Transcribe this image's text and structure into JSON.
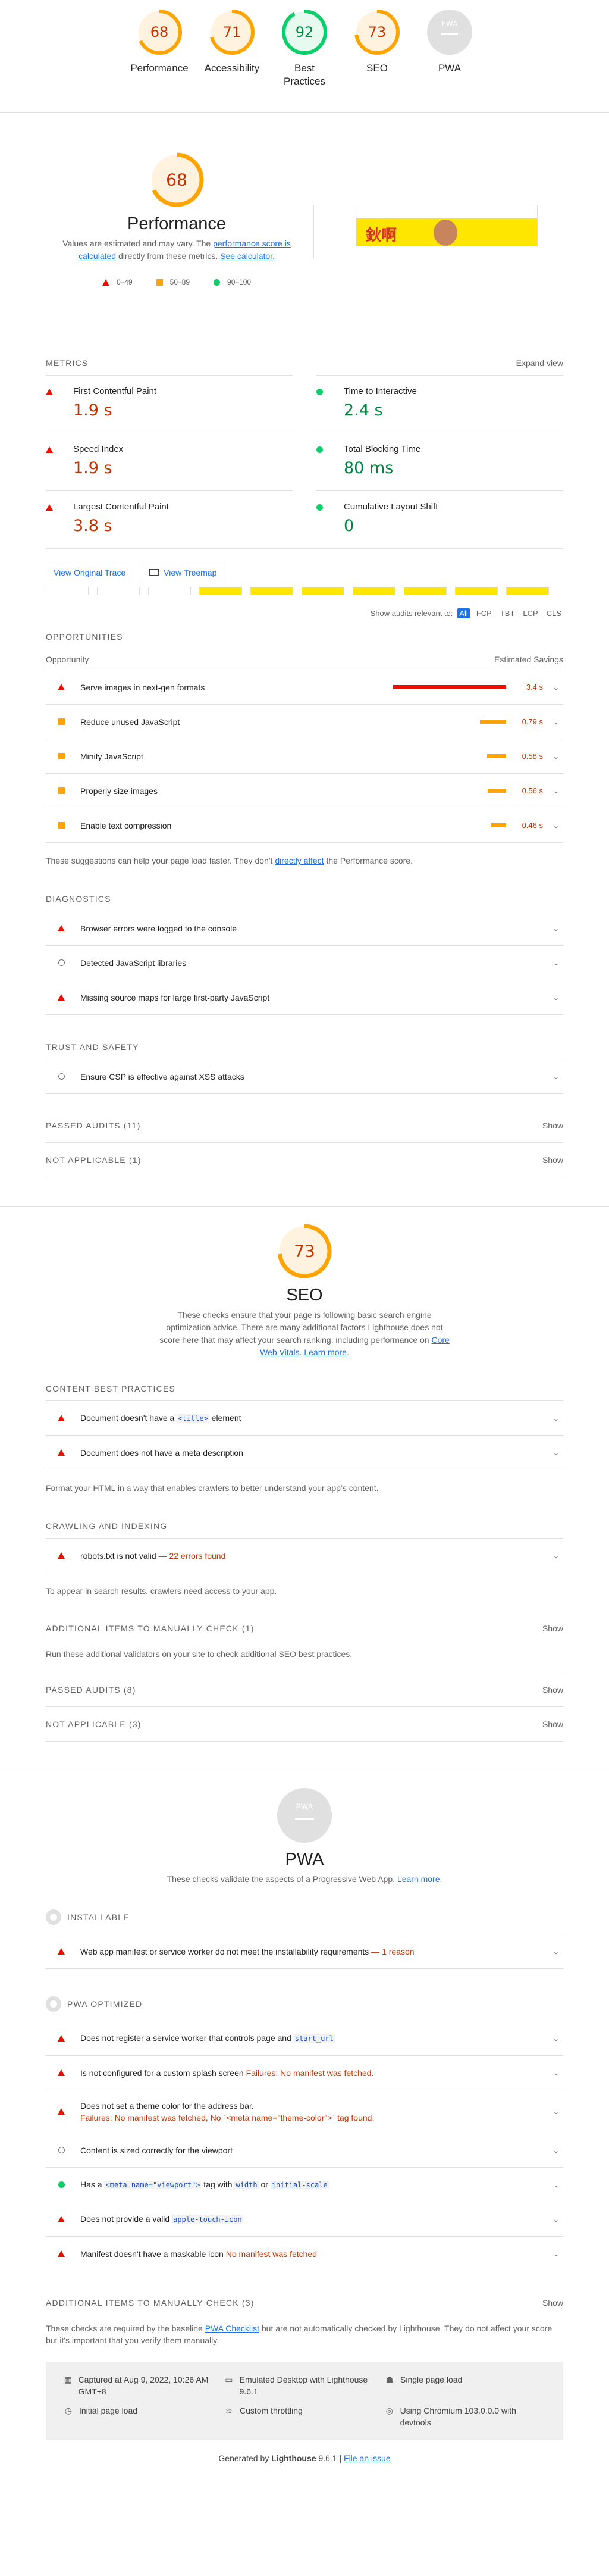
{
  "summary": [
    {
      "label": "Performance",
      "score": "68",
      "score_num": 68,
      "color": "#ffa400"
    },
    {
      "label": "Accessibility",
      "score": "71",
      "score_num": 71,
      "color": "#ffa400"
    },
    {
      "label": "Best Practices",
      "score": "92",
      "score_num": 92,
      "color": "#0cce6b"
    },
    {
      "label": "SEO",
      "score": "73",
      "score_num": 73,
      "color": "#ffa400"
    },
    {
      "label": "PWA",
      "score": "PWA",
      "score_num": 0,
      "color": "#e0e0e0"
    }
  ],
  "performance": {
    "score": "68",
    "title": "Performance",
    "desc_1": "Values are estimated and may vary. The ",
    "desc_link_1": "performance score is calculated",
    "desc_2": " directly from these metrics. ",
    "desc_link_2": "See calculator.",
    "legend": [
      "0–49",
      "50–89",
      "90–100"
    ],
    "metrics_label": "METRICS",
    "expand_view": "Expand view",
    "metrics": [
      {
        "name": "First Contentful Paint",
        "value": "1.9 s",
        "status": "fail"
      },
      {
        "name": "Time to Interactive",
        "value": "2.4 s",
        "status": "pass"
      },
      {
        "name": "Speed Index",
        "value": "1.9 s",
        "status": "fail"
      },
      {
        "name": "Total Blocking Time",
        "value": "80 ms",
        "status": "pass"
      },
      {
        "name": "Largest Contentful Paint",
        "value": "3.8 s",
        "status": "fail"
      },
      {
        "name": "Cumulative Layout Shift",
        "value": "0",
        "status": "pass"
      }
    ],
    "view_trace": "View Original Trace",
    "view_treemap": "View Treemap",
    "filter_label": "Show audits relevant to:",
    "filters": [
      "All",
      "FCP",
      "TBT",
      "LCP",
      "CLS"
    ],
    "opportunities_label": "OPPORTUNITIES",
    "opp_col_1": "Opportunity",
    "opp_col_2": "Estimated Savings",
    "opportunities": [
      {
        "name": "Serve images in next-gen formats",
        "savings": "3.4 s",
        "status": "fail",
        "fraction": 1.0
      },
      {
        "name": "Reduce unused JavaScript",
        "savings": "0.79 s",
        "status": "average",
        "fraction": 0.23
      },
      {
        "name": "Minify JavaScript",
        "savings": "0.58 s",
        "status": "average",
        "fraction": 0.17
      },
      {
        "name": "Properly size images",
        "savings": "0.56 s",
        "status": "average",
        "fraction": 0.165
      },
      {
        "name": "Enable text compression",
        "savings": "0.46 s",
        "status": "average",
        "fraction": 0.135
      }
    ],
    "opp_note_1": "These suggestions can help your page load faster. They don't ",
    "opp_note_link": "directly affect",
    "opp_note_2": " the Performance score.",
    "diagnostics_label": "DIAGNOSTICS",
    "diagnostics": [
      {
        "name": "Browser errors were logged to the console",
        "status": "fail"
      },
      {
        "name": "Detected JavaScript libraries",
        "status": "info"
      },
      {
        "name": "Missing source maps for large first-party JavaScript",
        "status": "fail"
      }
    ],
    "trust_label": "TRUST AND SAFETY",
    "trust": [
      {
        "name": "Ensure CSP is effective against XSS attacks",
        "status": "info"
      }
    ],
    "passed": "PASSED AUDITS (11)",
    "not_applicable": "NOT APPLICABLE (1)",
    "show": "Show"
  },
  "seo": {
    "score": "73",
    "title": "SEO",
    "desc_1": "These checks ensure that your page is following basic search engine optimization advice. There are many additional factors Lighthouse does not score here that may affect your search ranking, including performance on ",
    "desc_link_1": "Core Web Vitals",
    "desc_2": ". ",
    "desc_link_2": "Learn more",
    "desc_3": ".",
    "content_label": "CONTENT BEST PRACTICES",
    "audit_1_pre": "Document doesn't have a ",
    "audit_1_code": "<title>",
    "audit_1_post": " element",
    "audit_2": "Document does not have a meta description",
    "content_note": "Format your HTML in a way that enables crawlers to better understand your app’s content.",
    "crawl_label": "CRAWLING AND INDEXING",
    "robots": "robots.txt is not valid",
    "robots_warn": " — 22 errors found",
    "crawl_note": "To appear in search results, crawlers need access to your app.",
    "manual": "ADDITIONAL ITEMS TO MANUALLY CHECK (1)",
    "manual_note": "Run these additional validators on your site to check additional SEO best practices.",
    "passed": "PASSED AUDITS (8)",
    "not_applicable": "NOT APPLICABLE (3)",
    "show": "Show"
  },
  "pwa": {
    "badge": "PWA",
    "title": "PWA",
    "desc_1": "These checks validate the aspects of a Progressive Web App. ",
    "desc_link": "Learn more",
    "desc_2": ".",
    "installable_label": "INSTALLABLE",
    "installable_audit": "Web app manifest or service worker do not meet the installability requirements",
    "installable_warn": " — 1 reason",
    "optimized_label": "PWA OPTIMIZED",
    "sw_pre": "Does not register a service worker that controls page and ",
    "sw_code": "start_url",
    "splash": "Is not configured for a custom splash screen ",
    "splash_warn": "Failures: No manifest was fetched.",
    "theme": "Does not set a theme color for the address bar.",
    "theme_warn": "Failures: No manifest was fetched, No `<meta name=\"theme-color\">` tag found.",
    "viewport": "Content is sized correctly for the viewport",
    "has_a": "Has a ",
    "meta_code": "<meta name=\"viewport\">",
    "tag_with": " tag with ",
    "width_code": "width",
    "or": " or ",
    "scale_code": "initial-scale",
    "touch_pre": "Does not provide a valid ",
    "touch_code": "apple-touch-icon",
    "maskable": "Manifest doesn't have a maskable icon ",
    "maskable_warn": "No manifest was fetched",
    "manual": "ADDITIONAL ITEMS TO MANUALLY CHECK (3)",
    "show": "Show",
    "manual_note_1": "These checks are required by the baseline ",
    "manual_note_link": "PWA Checklist",
    "manual_note_2": " but are not automatically checked by Lighthouse. They do not affect your score but it's important that you verify them manually."
  },
  "footer": {
    "captured": "Captured at Aug 9, 2022, 10:26 AM GMT+8",
    "initial": "Initial page load",
    "emulated": "Emulated Desktop with Lighthouse 9.6.1",
    "throttling": "Custom throttling",
    "single": "Single page load",
    "chromium": "Using Chromium 103.0.0.0 with devtools",
    "generated_1": "Generated by ",
    "generated_brand": "Lighthouse",
    "generated_2": " 9.6.1 | ",
    "file_issue": "File an issue"
  },
  "colors": {
    "fail": "#eb0f00",
    "average": "#ffa400",
    "pass": "#0cce6b"
  }
}
